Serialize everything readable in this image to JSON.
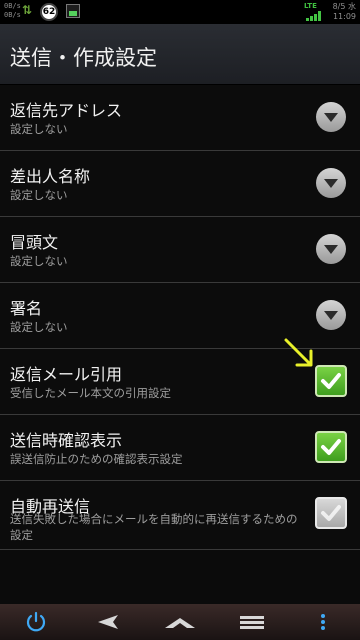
{
  "status": {
    "speed_up": "0B/s",
    "speed_down": "0B/s",
    "temperature": "62",
    "network": "LTE",
    "date": "8/5 水",
    "time": "11:09"
  },
  "header": {
    "title": "送信・作成設定"
  },
  "settings": [
    {
      "title": "返信先アドレス",
      "summary": "設定しない",
      "control": "dropdown"
    },
    {
      "title": "差出人名称",
      "summary": "設定しない",
      "control": "dropdown"
    },
    {
      "title": "冒頭文",
      "summary": "設定しない",
      "control": "dropdown"
    },
    {
      "title": "署名",
      "summary": "設定しない",
      "control": "dropdown"
    },
    {
      "title": "返信メール引用",
      "summary": "受信したメール本文の引用設定",
      "control": "checkbox",
      "checked": true
    },
    {
      "title": "送信時確認表示",
      "summary": "誤送信防止のための確認表示設定",
      "control": "checkbox",
      "checked": true
    },
    {
      "title": "自動再送信",
      "summary": "送信失敗した場合にメールを自動的に再送信するための設定",
      "control": "checkbox",
      "checked": false
    }
  ],
  "colors": {
    "accent_green": "#5cbf2a",
    "annotation_arrow": "#e8f02a"
  },
  "navbar": {
    "icons": [
      "power-icon",
      "back-icon",
      "home-icon",
      "recent-apps-icon",
      "menu-icon"
    ]
  }
}
